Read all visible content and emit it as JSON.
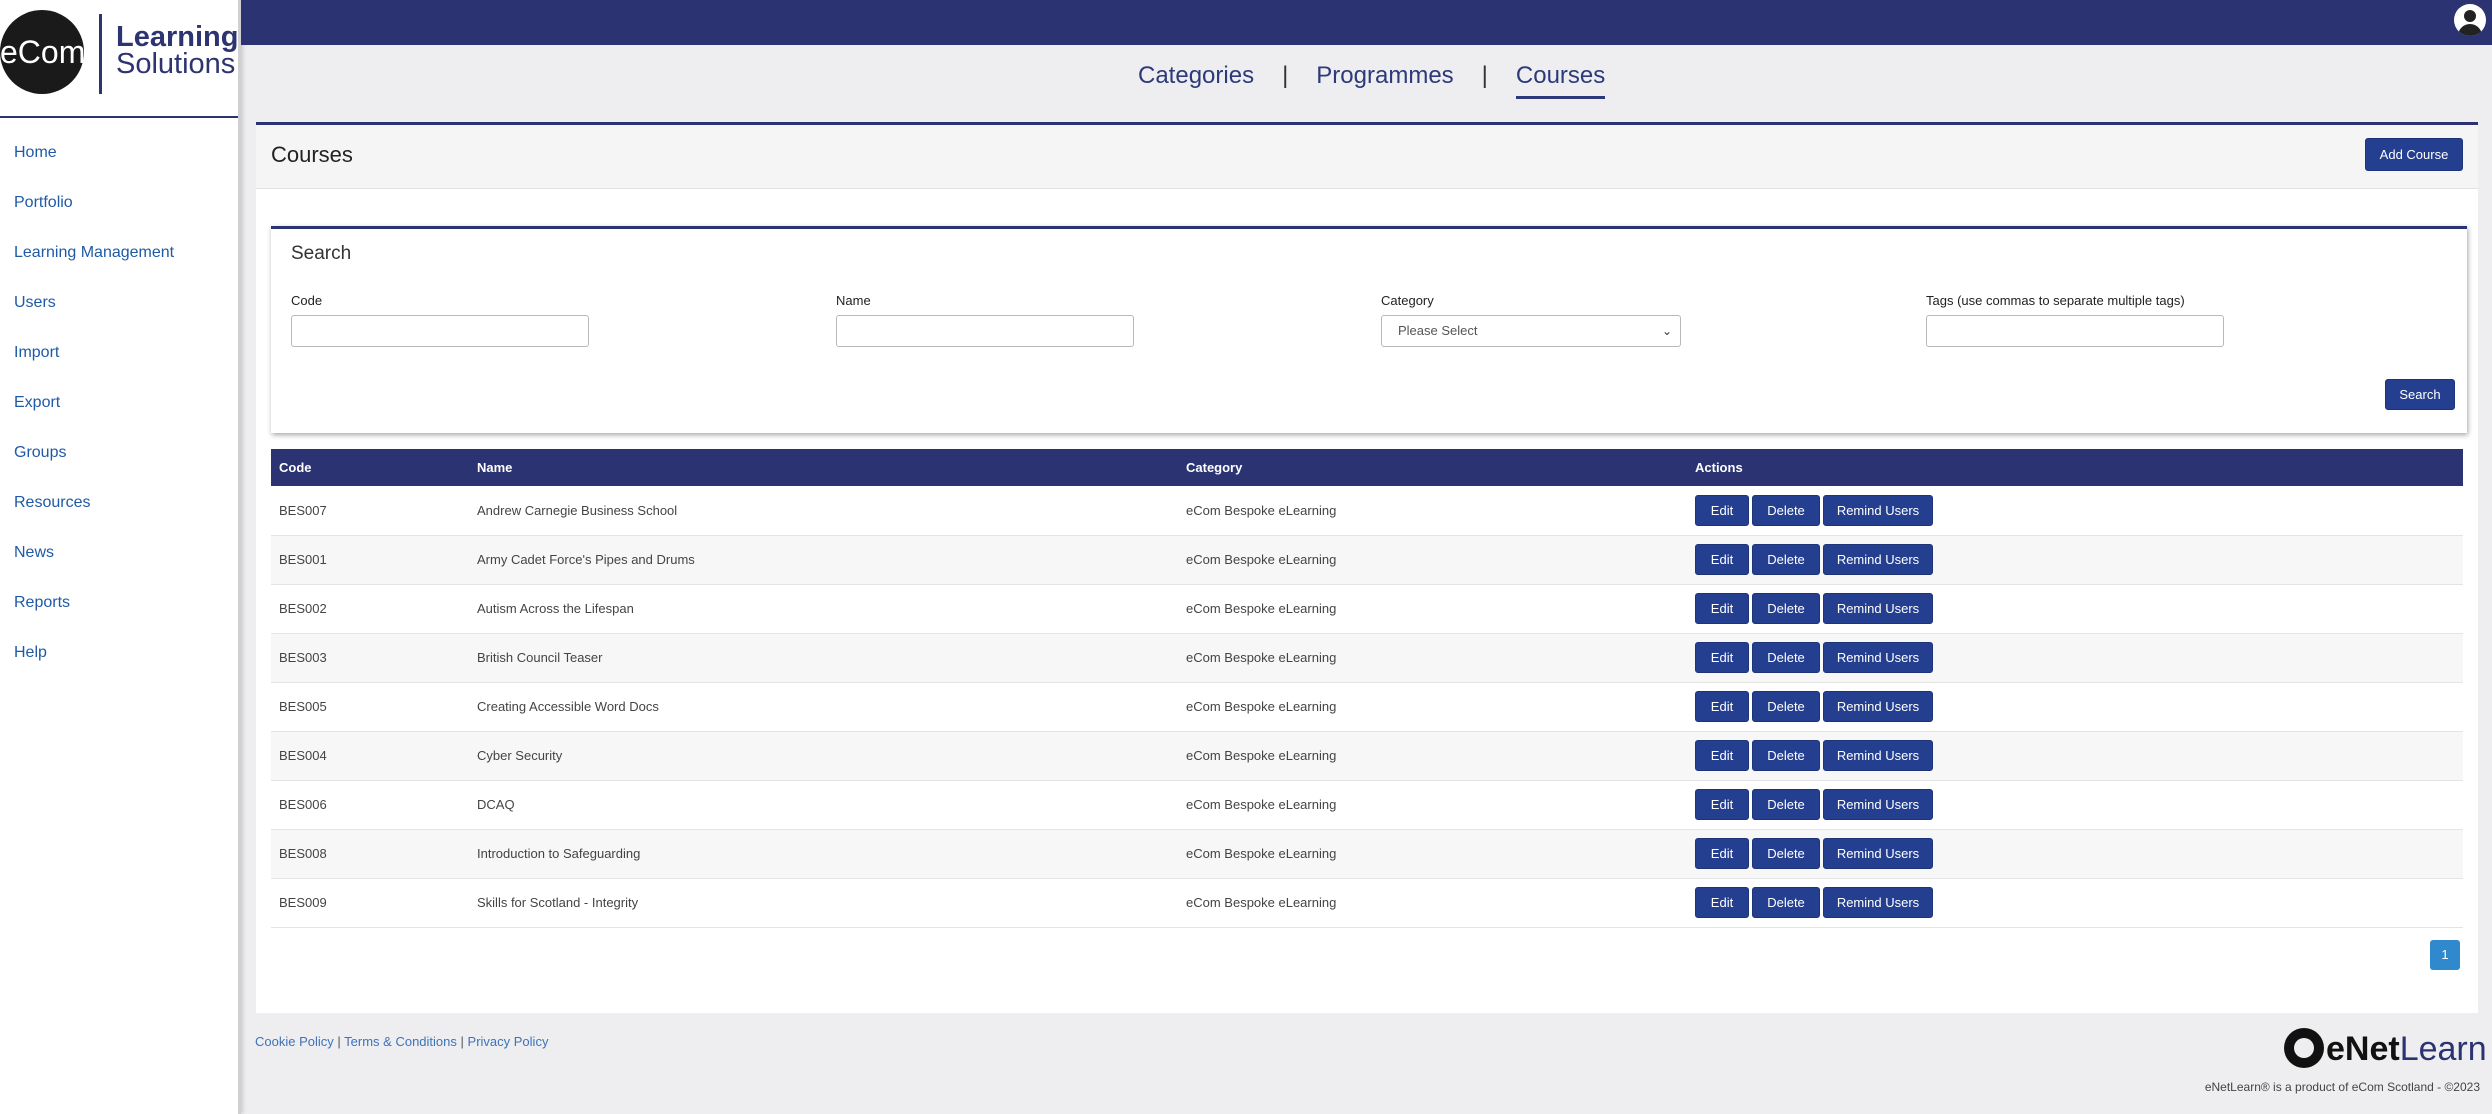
{
  "logo": {
    "mark": "eCom",
    "line1": "Learning",
    "line2": "Solutions"
  },
  "sidebar": {
    "items": [
      {
        "label": "Home"
      },
      {
        "label": "Portfolio"
      },
      {
        "label": "Learning Management"
      },
      {
        "label": "Users"
      },
      {
        "label": "Import"
      },
      {
        "label": "Export"
      },
      {
        "label": "Groups"
      },
      {
        "label": "Resources"
      },
      {
        "label": "News"
      },
      {
        "label": "Reports"
      },
      {
        "label": "Help"
      }
    ]
  },
  "tabs": [
    {
      "label": "Categories"
    },
    {
      "label": "Programmes"
    },
    {
      "label": "Courses",
      "active": true
    }
  ],
  "tab_separator": "|",
  "page": {
    "title": "Courses",
    "add_label": "Add Course"
  },
  "search": {
    "title": "Search",
    "code_label": "Code",
    "name_label": "Name",
    "category_label": "Category",
    "category_value": "Please Select",
    "tags_label": "Tags (use commas to separate multiple tags)",
    "button_label": "Search"
  },
  "table": {
    "headers": [
      "Code",
      "Name",
      "Category",
      "Actions"
    ],
    "rows": [
      {
        "code": "BES007",
        "name": "Andrew Carnegie Business School",
        "category": "eCom Bespoke eLearning"
      },
      {
        "code": "BES001",
        "name": "Army Cadet Force's Pipes and Drums",
        "category": "eCom Bespoke eLearning"
      },
      {
        "code": "BES002",
        "name": "Autism Across the Lifespan",
        "category": "eCom Bespoke eLearning"
      },
      {
        "code": "BES003",
        "name": "British Council Teaser",
        "category": "eCom Bespoke eLearning"
      },
      {
        "code": "BES005",
        "name": "Creating Accessible Word Docs",
        "category": "eCom Bespoke eLearning"
      },
      {
        "code": "BES004",
        "name": "Cyber Security",
        "category": "eCom Bespoke eLearning"
      },
      {
        "code": "BES006",
        "name": "DCAQ",
        "category": "eCom Bespoke eLearning"
      },
      {
        "code": "BES008",
        "name": "Introduction to Safeguarding",
        "category": "eCom Bespoke eLearning"
      },
      {
        "code": "BES009",
        "name": "Skills for Scotland - Integrity",
        "category": "eCom Bespoke eLearning"
      }
    ],
    "actions": {
      "edit": "Edit",
      "delete": "Delete",
      "remind": "Remind Users"
    }
  },
  "pagination": {
    "current": "1"
  },
  "footer": {
    "cookie": "Cookie Policy",
    "terms": "Terms & Conditions",
    "privacy": "Privacy Policy",
    "separator": "|",
    "brand_bold": "eNet",
    "brand_light": "Learn",
    "copyright": "eNetLearn® is a product of eCom Scotland - ©2023"
  },
  "colors": {
    "primary": "#2b3373",
    "button": "#243f8f",
    "link": "#1f5aa6",
    "pager": "#2f89cc"
  },
  "icons": {
    "user": "user-avatar-icon",
    "dropdown": "chevron-down-icon",
    "brand": "gear-icon"
  }
}
